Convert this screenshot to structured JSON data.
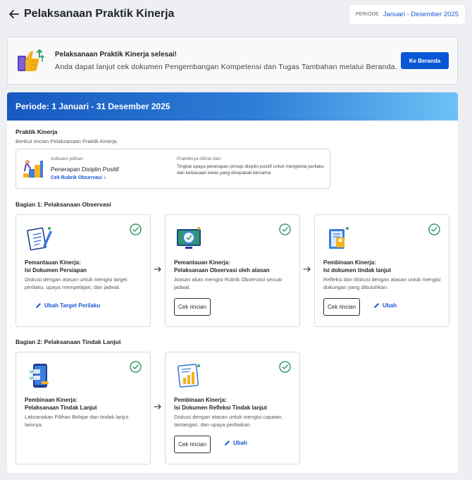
{
  "header": {
    "title": "Pelaksanaan Praktik Kinerja",
    "period_label": "PERIODE",
    "period_value": "Januari - Desember 2025"
  },
  "banner": {
    "title": "Pelaksanaan Praktik Kinerja selesai!",
    "subtitle": "Anda dapat lanjut cek dokumen Pengembangan Kompetensi dan Tugas Tambahan melalui Beranda.",
    "button": "Ke Beranda"
  },
  "period_header": "Periode: 1 Januari - 31 Desember 2025",
  "praktik": {
    "title": "Praktik Kinerja",
    "subtitle": "Berikut rincian Pelaksanaan Praktik Kinerja.",
    "indicator_label": "Indikator pilihan:",
    "indicator_value": "Penerapan Disiplin Positif",
    "indicator_link": "Cek Rubrik Observasi",
    "seen_label": "Praktiknya dilihat dari:",
    "seen_value": "Tingkat upaya penerapan prinsip disiplin positif untuk mengelola perilaku dan kebiasaan kelas yang disepakati bersama"
  },
  "bagian1": {
    "title": "Bagian 1: Pelaksanaan Observasi",
    "cards": [
      {
        "title_line1": "Pemantauan Kinerja:",
        "title_line2": "Isi Dokumen Persiapan",
        "desc": "Diskusi dengan atasan untuk mengisi target perilaku, upaya mempelajari, dan jadwal.",
        "link": "Ubah Target Perilaku"
      },
      {
        "title_line1": "Pemantauan Kinerja:",
        "title_line2": "Pelaksanaan Observasi oleh atasan",
        "desc": "Atasan akan mengisi Rubrik Observasi sesuai jadwal.",
        "button": "Cek rincian"
      },
      {
        "title_line1": "Pembinaan Kinerja:",
        "title_line2": "Isi dokumen tindak lanjut",
        "desc": "Refleksi dan diskusi dengan atasan untuk mengisi dukungan yang dibutuhkan.",
        "button": "Cek rincian",
        "link": "Ubah"
      }
    ]
  },
  "bagian2": {
    "title": "Bagian 2: Pelaksanaan Tindak Lanjut",
    "cards": [
      {
        "title_line1": "Pembinaan Kinerja:",
        "title_line2": "Pelaksanaan Tindak Lanjut",
        "desc": "Laksanakan Pilihan Belajar dan tindak lanjut lainnya."
      },
      {
        "title_line1": "Pembinaan Kinerja:",
        "title_line2": "Isi Dokumen Refleksi Tindak lanjut",
        "desc": "Diskusi dengan atasan untuk mengisi capaian, tantangan, dan upaya perbaikan.",
        "button": "Cek rincian",
        "link": "Ubah"
      }
    ]
  },
  "icons": {
    "back": "arrow-left-icon",
    "check": "check-circle-icon",
    "pencil": "pencil-icon",
    "arrow": "arrow-right-icon"
  },
  "colors": {
    "primary": "#0a57d6",
    "link": "#1a56d6",
    "success": "#3a9a6d",
    "header_gradient_start": "#1759c2",
    "header_gradient_end": "#6ec1f6"
  }
}
